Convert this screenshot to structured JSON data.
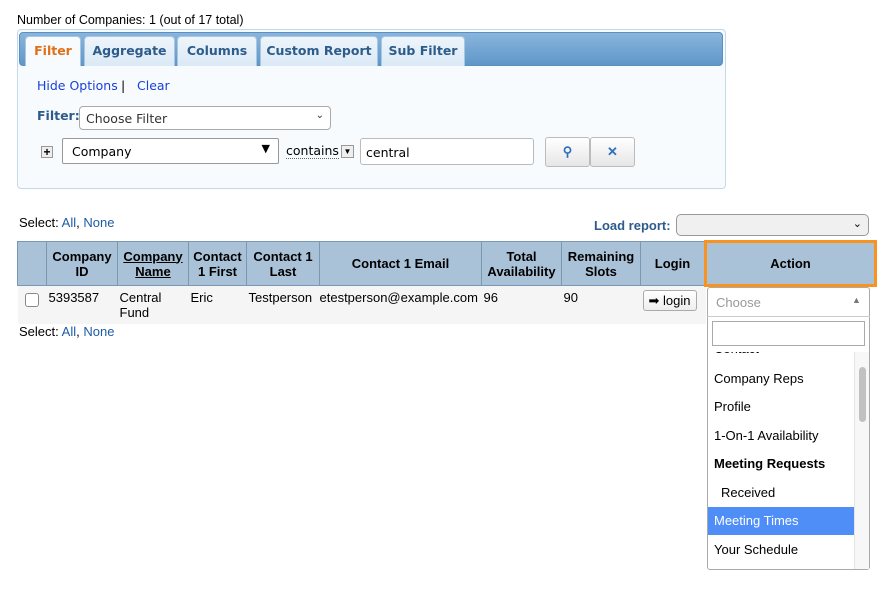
{
  "summary": "Number of Companies: 1 (out of 17 total)",
  "tabs": [
    "Filter",
    "Aggregate",
    "Columns",
    "Custom Report",
    "Sub Filter"
  ],
  "options": {
    "hide": "Hide Options",
    "sep": "|",
    "clear": "Clear"
  },
  "filter": {
    "label": "Filter:",
    "choose": "Choose Filter",
    "field": "Company",
    "operator": "contains",
    "value": "central"
  },
  "select": {
    "label": "Select:",
    "all": "All",
    "comma": ",",
    "none": "None"
  },
  "load_report": {
    "label": "Load report:",
    "value": ""
  },
  "table": {
    "headers": [
      "Company ID",
      "Company Name",
      "Contact 1 First",
      "Contact 1 Last",
      "Contact 1 Email",
      "Total Availability",
      "Remaining Slots",
      "Login",
      "Action"
    ],
    "rows": [
      {
        "id": "5393587",
        "name": "Central Fund",
        "first": "Eric",
        "last": "Testperson",
        "email": "etestperson@example.com",
        "total": "96",
        "remaining": "90",
        "login": "login"
      }
    ]
  },
  "action_dropdown": {
    "placeholder": "Choose",
    "search": "",
    "items": [
      "Contact",
      "Company Reps",
      "Profile",
      "1-On-1 Availability",
      "Meeting Requests",
      "Received",
      "Meeting Times",
      "Your Schedule"
    ],
    "selected": "Meeting Times"
  },
  "colors": {
    "accent": "#f7931e",
    "highlight": "#4f8ef7",
    "header": "#aac2d8"
  }
}
